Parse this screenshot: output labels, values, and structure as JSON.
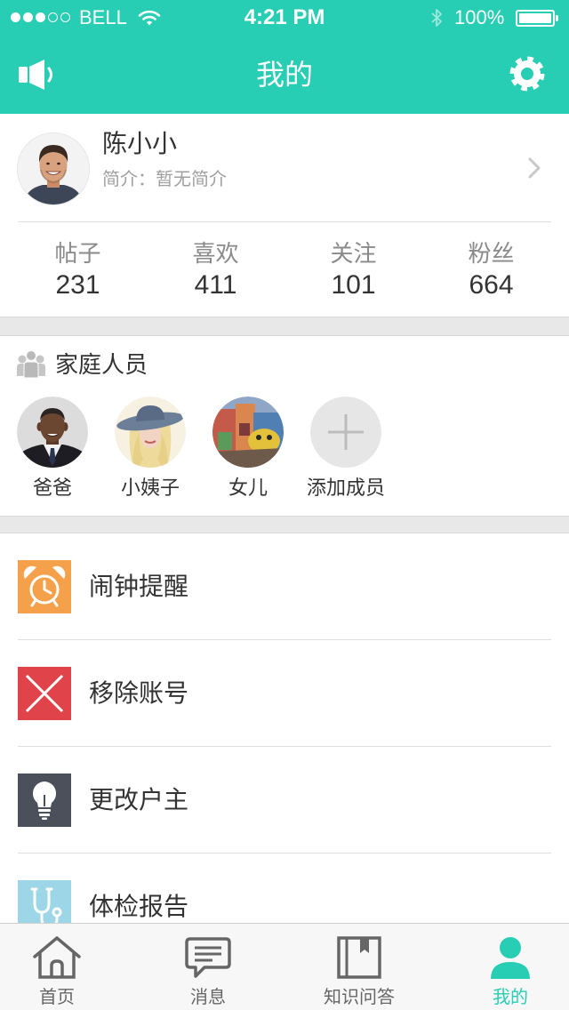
{
  "status_bar": {
    "carrier": "BELL",
    "time": "4:21 PM",
    "battery_text": "100%",
    "signal_level": 3,
    "signal_max": 5,
    "battery_level": 1.0
  },
  "nav": {
    "title": "我的",
    "left_icon": "speaker-icon",
    "right_icon": "gear-icon"
  },
  "profile": {
    "name": "陈小小",
    "bio": "简介：暂无简介",
    "chevron_icon": "chevron-right-icon"
  },
  "stats": [
    {
      "label": "帖子",
      "value": "231"
    },
    {
      "label": "喜欢",
      "value": "411"
    },
    {
      "label": "关注",
      "value": "101"
    },
    {
      "label": "粉丝",
      "value": "664"
    }
  ],
  "family": {
    "title": "家庭人员",
    "icon": "family-group-icon",
    "members": [
      {
        "name": "爸爸"
      },
      {
        "name": "小姨子"
      },
      {
        "name": "女儿"
      }
    ],
    "add_label": "添加成员",
    "add_icon": "plus-icon"
  },
  "menu": [
    {
      "label": "闹钟提醒",
      "icon": "alarm-clock-icon",
      "color": "#f5a04a"
    },
    {
      "label": "移除账号",
      "icon": "close-x-icon",
      "color": "#e0434a"
    },
    {
      "label": "更改户主",
      "icon": "lightbulb-icon",
      "color": "#4b505b"
    },
    {
      "label": "体检报告",
      "icon": "stethoscope-icon",
      "color": "#9dd6e6"
    }
  ],
  "tabs": [
    {
      "label": "首页",
      "icon": "home-icon",
      "active": false
    },
    {
      "label": "消息",
      "icon": "message-icon",
      "active": false
    },
    {
      "label": "知识问答",
      "icon": "book-icon",
      "active": false
    },
    {
      "label": "我的",
      "icon": "person-icon",
      "active": true
    }
  ],
  "colors": {
    "accent": "#27ceb3",
    "text_primary": "#333333",
    "text_secondary": "#a0a0a0",
    "separator": "#e8e8e8"
  }
}
